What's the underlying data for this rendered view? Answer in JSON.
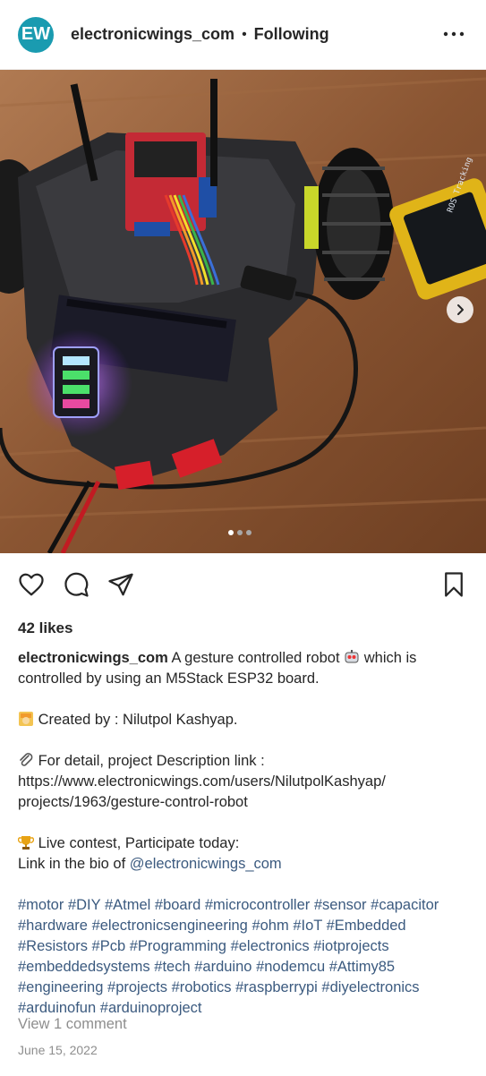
{
  "header": {
    "avatar_initials": "EW",
    "username": "electronicwings_com",
    "separator": "•",
    "follow_status": "Following",
    "more_icon": "more-horizontal-icon"
  },
  "photo": {
    "description_icon": "robot-photo",
    "carousel_count": 3,
    "carousel_active": 0,
    "device_screen_text": "ROS Tracking Gesture"
  },
  "actions": {
    "like_icon": "heart-icon",
    "comment_icon": "comment-icon",
    "share_icon": "send-icon",
    "save_icon": "bookmark-icon"
  },
  "likes": "42 likes",
  "caption": {
    "username": "electronicwings_com",
    "line1": "A gesture controlled robot",
    "line1_emoji": "robot-emoji",
    "line1_end": "which is controlled by using an M5Stack ESP32 board.",
    "created_emoji": "worker-emoji",
    "created_by": "Created by : Nilutpol Kashyap.",
    "link_emoji": "paperclip-emoji",
    "detail_label": "For detail, project Description link :",
    "detail_url_1": "https://www.electronicwings.com/users/NilutpolKashyap/",
    "detail_url_2": "projects/1963/gesture-control-robot",
    "trophy_emoji": "trophy-emoji",
    "contest": "Live contest, Participate today:",
    "bio_text": "Link in the bio of",
    "bio_mention": "@electronicwings_com"
  },
  "hashtags": [
    "#motor",
    "#DIY",
    "#Atmel",
    "#board",
    "#microcontroller",
    "#sensor",
    "#capacitor",
    "#hardware",
    "#electronicsengineering",
    "#ohm",
    "#IoT",
    "#Embedded",
    "#Resistors",
    "#Pcb",
    "#Programming",
    "#electronics",
    "#iotprojects",
    "#embeddedsystems",
    "#tech",
    "#arduino",
    "#nodemcu",
    "#Attimy85",
    "#engineering",
    "#projects",
    "#robotics",
    "#raspberrypi",
    "#diyelectronics",
    "#arduinofun",
    "#arduinoproject"
  ],
  "comments_link": "View 1 comment",
  "date": "June 15, 2022",
  "colors": {
    "accent_link": "#3b5a7f",
    "avatar_bg": "#1a9bb0",
    "muted": "#8e8e8e"
  }
}
